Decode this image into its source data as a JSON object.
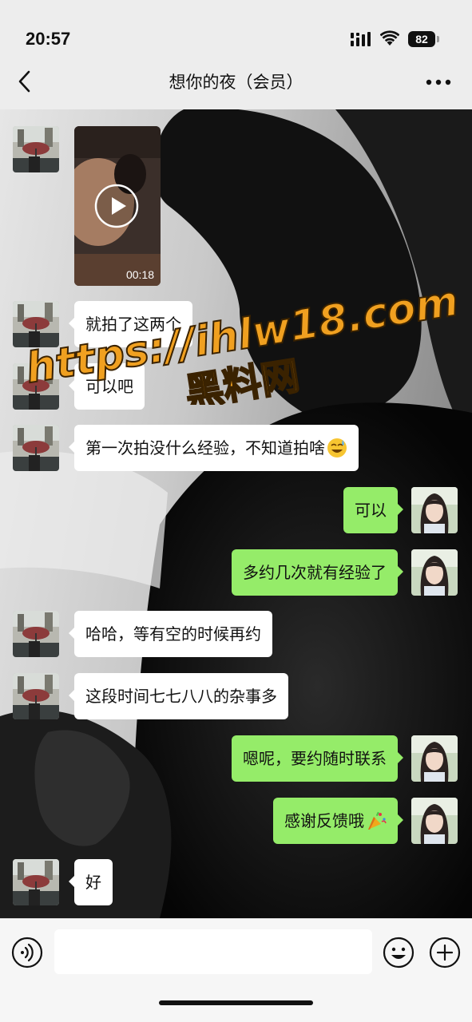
{
  "status_bar": {
    "time": "20:57",
    "battery": "82"
  },
  "nav": {
    "title": "想你的夜（会员）"
  },
  "video": {
    "duration": "00:18"
  },
  "watermark": {
    "line1": "https://ihlw18.com",
    "line2": "黑料网"
  },
  "messages": [
    {
      "side": "left",
      "text": "就拍了这两个"
    },
    {
      "side": "left",
      "text": "可以吧"
    },
    {
      "side": "left",
      "text": "第一次拍没什么经验，不知道拍啥",
      "emoji": "sweat-smile-emoji"
    },
    {
      "side": "right",
      "text": "可以"
    },
    {
      "side": "right",
      "text": "多约几次就有经验了"
    },
    {
      "side": "left",
      "text": "哈哈，等有空的时候再约"
    },
    {
      "side": "left",
      "text": "这段时间七七八八的杂事多"
    },
    {
      "side": "right",
      "text": "嗯呢，要约随时联系"
    },
    {
      "side": "right",
      "text": "感谢反馈哦",
      "emoji": "party-popper-emoji"
    },
    {
      "side": "left",
      "text": "好"
    }
  ],
  "input": {
    "placeholder": ""
  },
  "colors": {
    "sent_bubble": "#95ec69",
    "received_bubble": "#ffffff",
    "watermark": "#f0a020"
  }
}
